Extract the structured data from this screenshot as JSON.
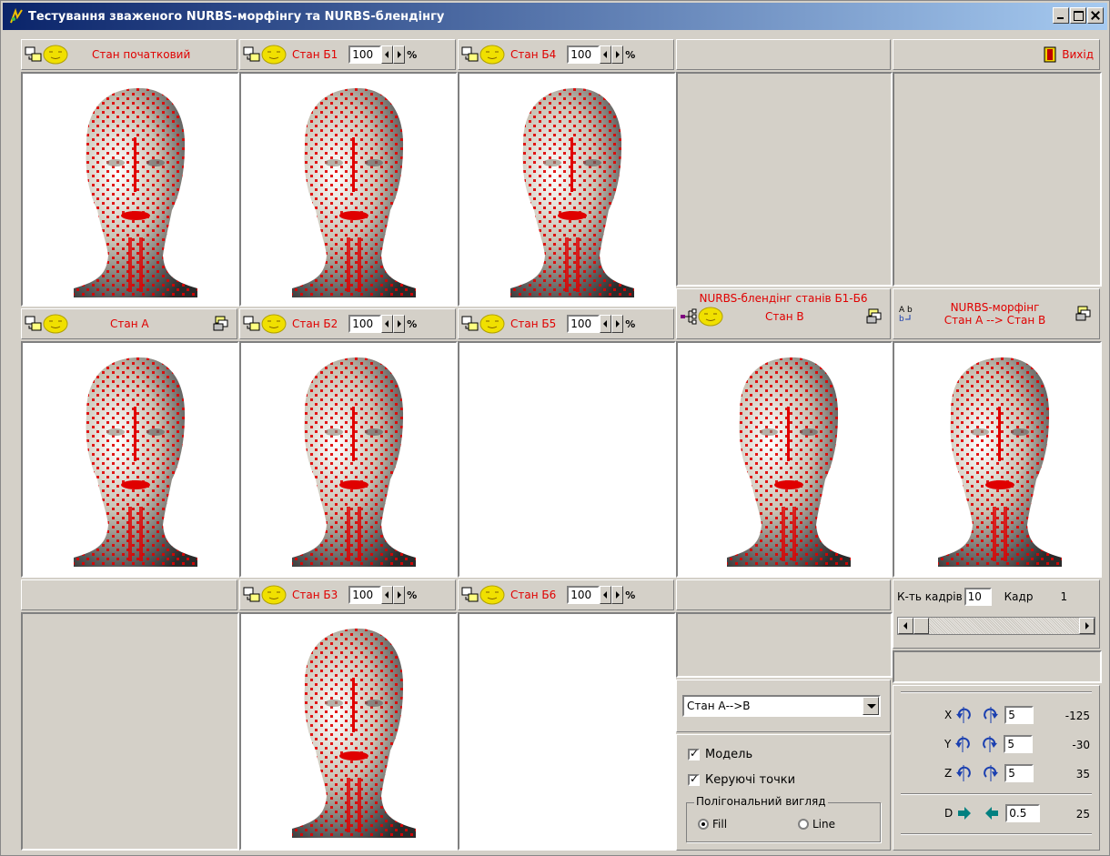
{
  "window": {
    "title": "Тестування зваженого NURBS-морфінгу та NURBS-блендінгу"
  },
  "panels": {
    "initial": {
      "label": "Стан початковий"
    },
    "b1": {
      "label": "Стан Б1",
      "weight": "100"
    },
    "b4": {
      "label": "Стан Б4",
      "weight": "100"
    },
    "exit": {
      "label": "Вихід"
    },
    "a": {
      "label": "Стан А"
    },
    "b2": {
      "label": "Стан Б2",
      "weight": "100"
    },
    "b5": {
      "label": "Стан Б5",
      "weight": "100"
    },
    "blend": {
      "title": "NURBS-блендінг станів Б1-Б6",
      "label": "Стан В"
    },
    "morph": {
      "title_line1": "NURBS-морфінг",
      "title_line2": "Стан А --> Стан В"
    },
    "b3": {
      "label": "Стан Б3",
      "weight": "100"
    },
    "b6": {
      "label": "Стан Б6",
      "weight": "100"
    }
  },
  "percent_sign": "%",
  "frames": {
    "count_label": "К-ть кадрів",
    "count_value": "10",
    "frame_label": "Кадр",
    "frame_value": "1",
    "slider_position": 0
  },
  "mode_select": {
    "value": "Стан А-->В"
  },
  "options": {
    "model": {
      "label": "Модель",
      "checked": true
    },
    "control_points": {
      "label": "Керуючі точки",
      "checked": true
    },
    "polygon_view": {
      "title": "Полігональний вигляд",
      "fill": "Fill",
      "line": "Line",
      "selected": "Fill"
    }
  },
  "rotation": {
    "x": {
      "axis": "X",
      "step": "5",
      "value": "-125"
    },
    "y": {
      "axis": "Y",
      "step": "5",
      "value": "-30"
    },
    "z": {
      "axis": "Z",
      "step": "5",
      "value": "35"
    },
    "d": {
      "axis": "D",
      "step": "0.5",
      "value": "25"
    }
  },
  "colors": {
    "accent": "#e00000",
    "title_start": "#0a246a",
    "title_end": "#a6caf0",
    "face": "#f0e000"
  }
}
